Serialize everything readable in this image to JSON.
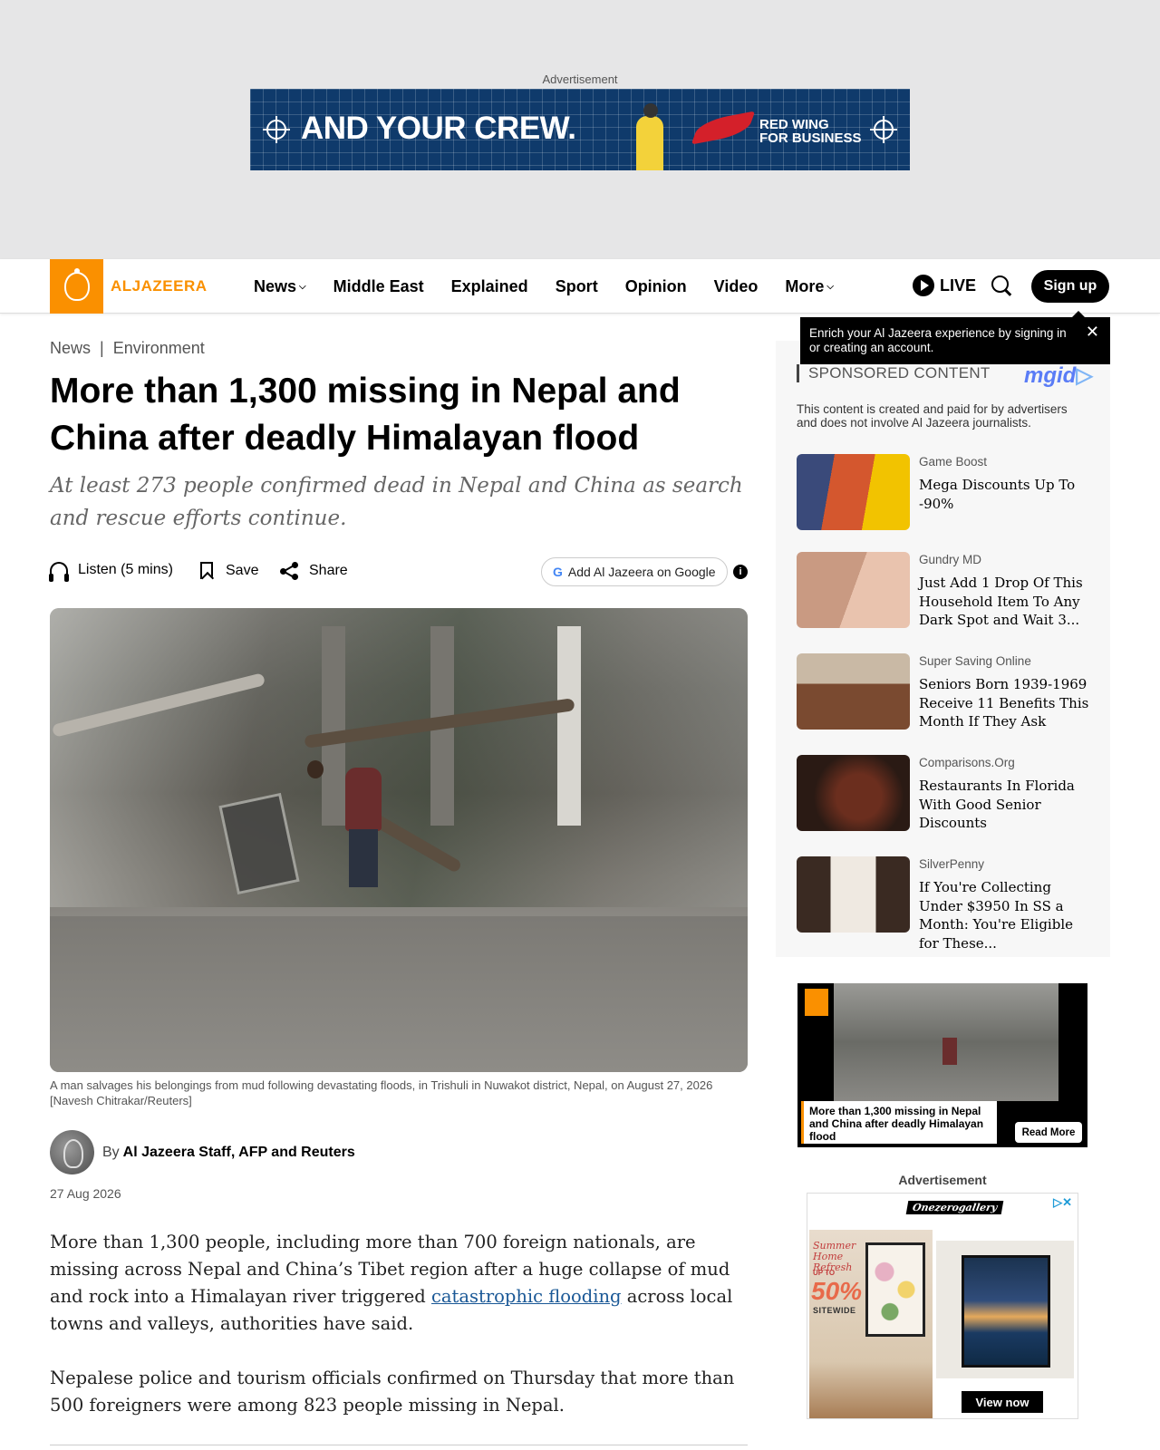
{
  "top_ad": {
    "label": "Advertisement",
    "headline": "AND YOUR CREW.",
    "brand_line1": "RED WING",
    "brand_line2": "FOR BUSINESS"
  },
  "header": {
    "logo_text": "ALJAZEERA",
    "nav": [
      {
        "label": "News",
        "has_dropdown": true
      },
      {
        "label": "Middle East",
        "has_dropdown": false
      },
      {
        "label": "Explained",
        "has_dropdown": false
      },
      {
        "label": "Sport",
        "has_dropdown": false
      },
      {
        "label": "Opinion",
        "has_dropdown": false
      },
      {
        "label": "Video",
        "has_dropdown": false
      },
      {
        "label": "More",
        "has_dropdown": true
      }
    ],
    "live_label": "LIVE",
    "signup_label": "Sign up",
    "accent_color": "#fa9000"
  },
  "tooltip": {
    "text": "Enrich your Al Jazeera experience by signing in or creating an account.",
    "close": "✕"
  },
  "article": {
    "breadcrumb": [
      "News",
      "Environment"
    ],
    "title": "More than 1,300 missing in Nepal and China after deadly Himalayan flood",
    "subtitle": "At least 273 people confirmed dead in Nepal and China as search and rescue efforts continue.",
    "actions": {
      "listen": "Listen (5 mins)",
      "save": "Save",
      "share": "Share",
      "google": "Add Al Jazeera on Google"
    },
    "caption": "A man salvages his belongings from mud following devastating floods, in Trishuli in Nuwakot district, Nepal, on August 27, 2026 [Navesh Chitrakar/Reuters]",
    "byline_prefix": "By",
    "authors": "Al Jazeera Staff, AFP and Reuters",
    "date": "27 Aug 2026",
    "p1_before": "More than 1,300 people, including more than 700 foreign nationals, are missing across Nepal and China’s Tibet region after a huge collapse of mud and rock into a Himalayan river triggered ",
    "p1_link": "catastrophic flooding",
    "p1_after": " across local towns and valleys, authorities have said.",
    "p2": "Nepalese police and tourism officials confirmed on Thursday that more than 500 for­eigners were among 823 people missing in Nepal."
  },
  "sponsored": {
    "header": "SPONSORED CONTENT",
    "provider": "mgid",
    "disclaimer": "This content is created and paid for by advertisers and does not involve Al Jazeera journalists.",
    "items": [
      {
        "source": "Game Boost",
        "title": "Mega Discounts Up To -90%"
      },
      {
        "source": "Gundry MD",
        "title": "Just Add 1 Drop Of This Household Item To Any Dark Spot and Wait 3..."
      },
      {
        "source": "Super Saving Online",
        "title": "Seniors Born 1939-1969 Receive 11 Benefits This Month If They Ask"
      },
      {
        "source": "Comparisons.Org",
        "title": "Restaurants In Florida With Good Senior Discounts"
      },
      {
        "source": "SilverPenny",
        "title": "If You're Collecting Under $3950 In SS a Month: You're Eligible for These..."
      }
    ]
  },
  "video_card": {
    "title": "More than 1,300 missing in Nepal and China after deadly Himalayan flood",
    "button": "Read More"
  },
  "side_ad": {
    "label": "Advertisement",
    "brand": "Onezerogallery",
    "promo_title": "Summer Home Refresh",
    "promo_upto": "UP TO",
    "promo_percent": "50%",
    "promo_sitewide": "SITEWIDE",
    "cta": "View now"
  }
}
